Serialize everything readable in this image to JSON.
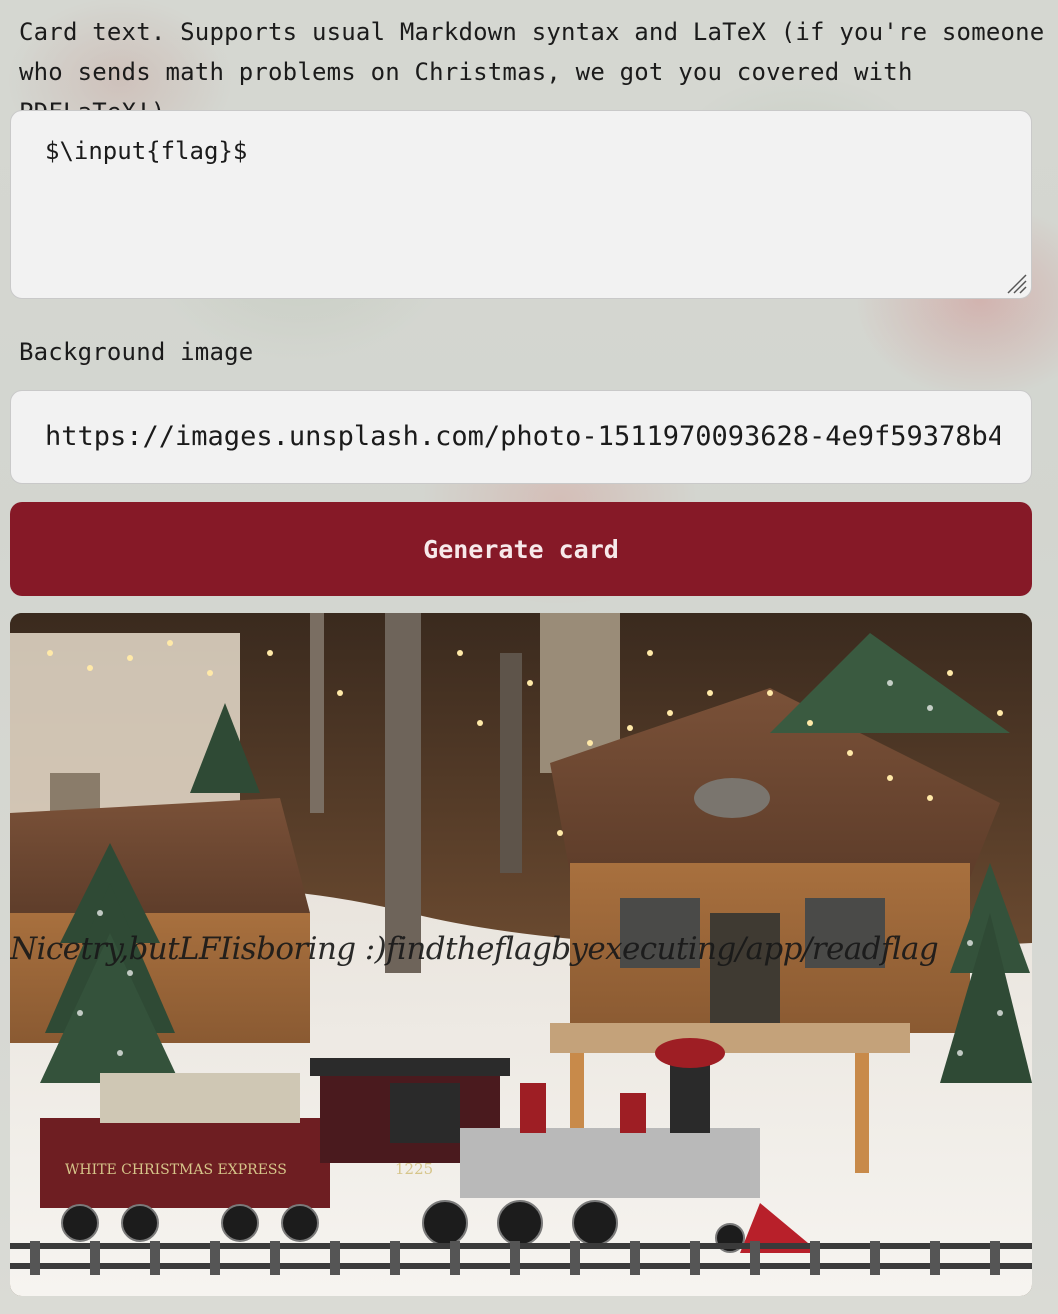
{
  "card_text": {
    "label": "Card text. Supports usual Markdown syntax and LaTeX (if you're someone who sends math problems on Christmas, we got you covered with PDFLaTeX!)",
    "value": "$\\input{flag}$"
  },
  "background": {
    "label": "Background image",
    "url": "https://images.unsplash.com/photo-1511970093628-4e9f59378b4c"
  },
  "generate_button": {
    "label": "Generate card"
  },
  "card_preview": {
    "rendered_text": "Nicetry,butLFIisboring :)findtheflagbyexecuting/app/readflag",
    "tender_text": "WHITE CHRISTMAS EXPRESS",
    "locomotive_number": "1225"
  },
  "colors": {
    "button": "#861927",
    "input_bg": "#f2f2f2"
  }
}
